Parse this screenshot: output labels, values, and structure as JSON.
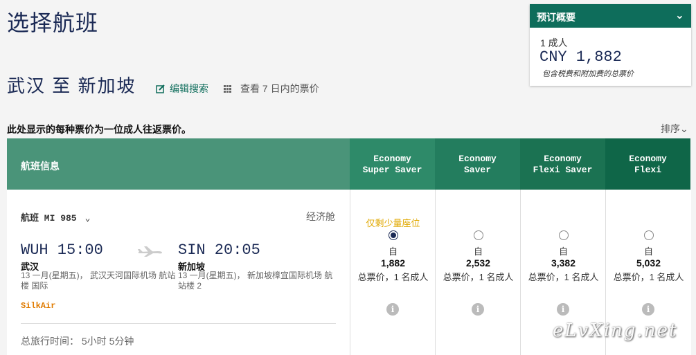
{
  "page": {
    "title": "选择航班",
    "route": "武汉 至 新加坡",
    "edit_search": "编辑搜索",
    "week_view": "查看 7 日内的票价",
    "fare_note": "此处显示的每种票价为一位成人往返票价。",
    "sort": "排序"
  },
  "summary": {
    "title": "预订概要",
    "passengers": "1 成人",
    "price": "CNY 1,882",
    "note": "包含税费和附加费的总票价"
  },
  "table": {
    "info_header": "航班信息",
    "fares": [
      {
        "name_line1": "Economy",
        "name_line2": "Super Saver",
        "seats_left": "仅剩少量座位",
        "from": "自",
        "amount": "1,882",
        "total_label": "总票价，1 名成人",
        "selected": true
      },
      {
        "name_line1": "Economy",
        "name_line2": "Saver",
        "seats_left": "",
        "from": "自",
        "amount": "2,532",
        "total_label": "总票价，1 名成人",
        "selected": false
      },
      {
        "name_line1": "Economy",
        "name_line2": "Flexi Saver",
        "seats_left": "",
        "from": "自",
        "amount": "3,382",
        "total_label": "总票价，1 名成人",
        "selected": false
      },
      {
        "name_line1": "Economy",
        "name_line2": "Flexi",
        "seats_left": "",
        "from": "自",
        "amount": "5,032",
        "total_label": "总票价，1 名成人",
        "selected": false
      }
    ]
  },
  "flight": {
    "number": "航班 MI 985",
    "cabin": "经济舱",
    "departure": {
      "time": "WUH 15:00",
      "city": "武汉",
      "detail": "13 一月(星期五)， 武汉天河国际机场 航站楼 国际"
    },
    "arrival": {
      "time": "SIN 20:05",
      "city": "新加坡",
      "detail": "13 一月(星期五)， 新加坡樟宜国际机场 航站楼 2"
    },
    "carrier": "SilkAir",
    "duration": "总旅行时间： 5小时 5分钟"
  },
  "watermark": "eLvXing.net",
  "colors": {
    "brand_green": "#0e6d5b",
    "navy": "#1b2a55",
    "warning": "#e0a800",
    "carrier": "#e07b00"
  },
  "icons": [
    "chevron-down-icon",
    "edit-icon",
    "calendar-grid-icon",
    "plane-icon",
    "info-icon"
  ]
}
